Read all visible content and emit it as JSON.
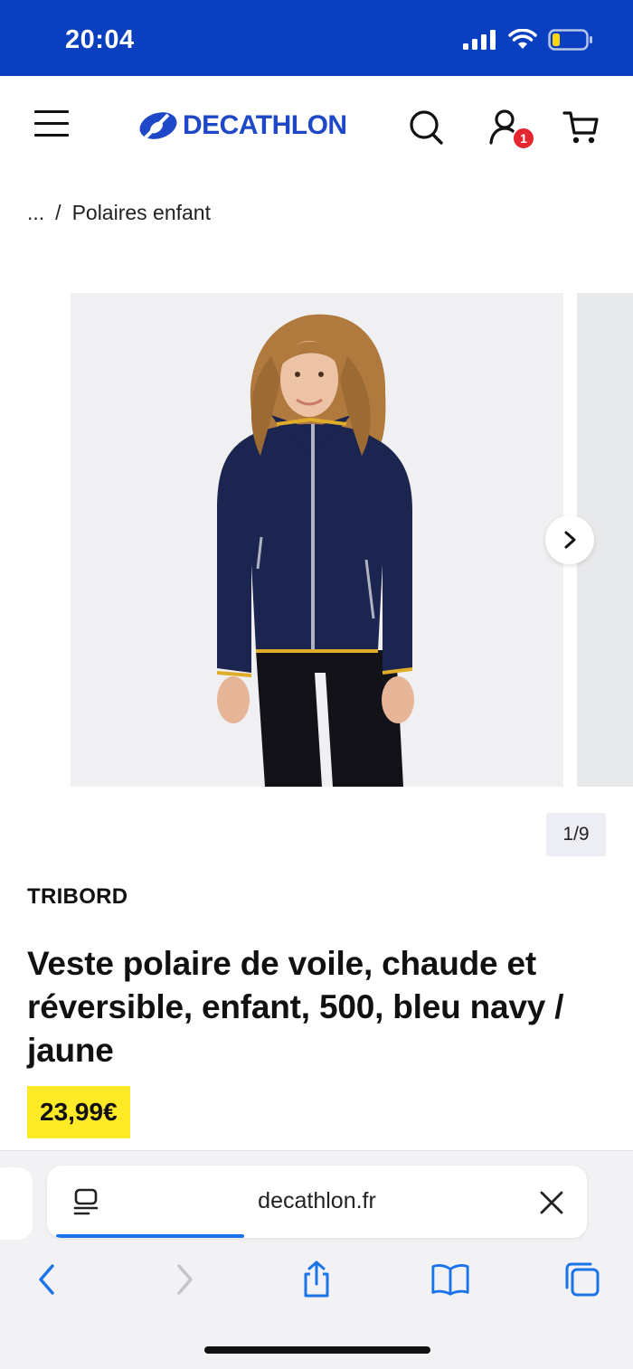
{
  "status_bar": {
    "time": "20:04"
  },
  "header": {
    "logo_text": "DECATHLON",
    "account_badge": "1"
  },
  "breadcrumb": {
    "ellipsis": "...",
    "separator": "/",
    "current": "Polaires enfant"
  },
  "gallery": {
    "counter": "1/9"
  },
  "product": {
    "brand": "TRIBORD",
    "title": "Veste polaire de voile, chaude et réversible, enfant, 500, bleu navy / jaune",
    "price": "23,99€"
  },
  "browser": {
    "url": "decathlon.fr",
    "load_progress": 0.36
  },
  "colors": {
    "brand_blue": "#0a3fbf",
    "logo_blue": "#1e48c8",
    "price_yellow": "#ffea28",
    "badge_red": "#e3262f",
    "ios_blue": "#1a73e8"
  }
}
